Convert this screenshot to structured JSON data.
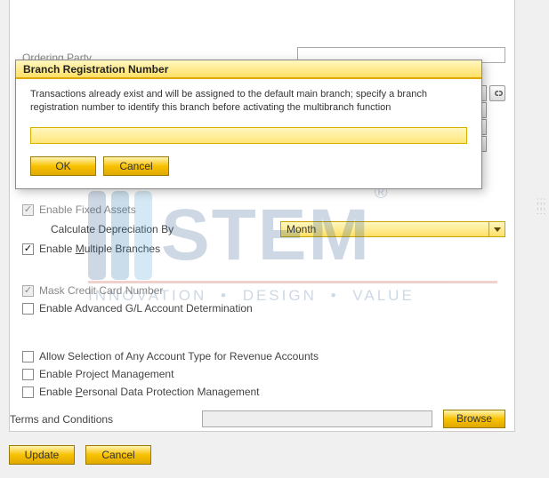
{
  "bgField": {
    "label": "Ordering Party",
    "value": ""
  },
  "dialog": {
    "title": "Branch Registration Number",
    "message": "Transactions already exist and will be assigned to the default main branch; specify a branch registration number to identify this branch before activating the multibranch function",
    "input_value": "",
    "ok_label": "OK",
    "cancel_label": "Cancel"
  },
  "section1": {
    "fixed_assets": {
      "label": "Enable Fixed Assets",
      "checked": true,
      "disabled": true
    },
    "calc_label": "Calculate Depreciation By",
    "calc_value": "Month",
    "multi_branch": {
      "label_pre": "Enable ",
      "label_ul": "M",
      "label_post": "ultiple Branches",
      "checked": true,
      "disabled": false
    }
  },
  "section2": {
    "mask_cc": {
      "label": "Mask Credit Card Number",
      "checked": true,
      "disabled": true
    },
    "adv_gl": {
      "label": "Enable Advanced G/L Account Determination",
      "checked": false,
      "disabled": false
    }
  },
  "section3": {
    "allow_sel": {
      "label": "Allow Selection of Any Account Type for Revenue Accounts",
      "checked": false
    },
    "proj_mgmt": {
      "label": "Enable Project Management",
      "checked": false
    },
    "pdpm": {
      "label_pre": "Enable ",
      "label_ul": "P",
      "label_post": "ersonal Data Protection Management",
      "checked": false
    }
  },
  "terms": {
    "label": "Terms and Conditions",
    "value": "",
    "browse_label": "Browse"
  },
  "bottom": {
    "update_label": "Update",
    "cancel_label": "Cancel"
  },
  "watermark": {
    "brand": "STEM",
    "tag1": "INNOVATION",
    "tag2": "DESIGN",
    "tag3": "VALUE"
  }
}
